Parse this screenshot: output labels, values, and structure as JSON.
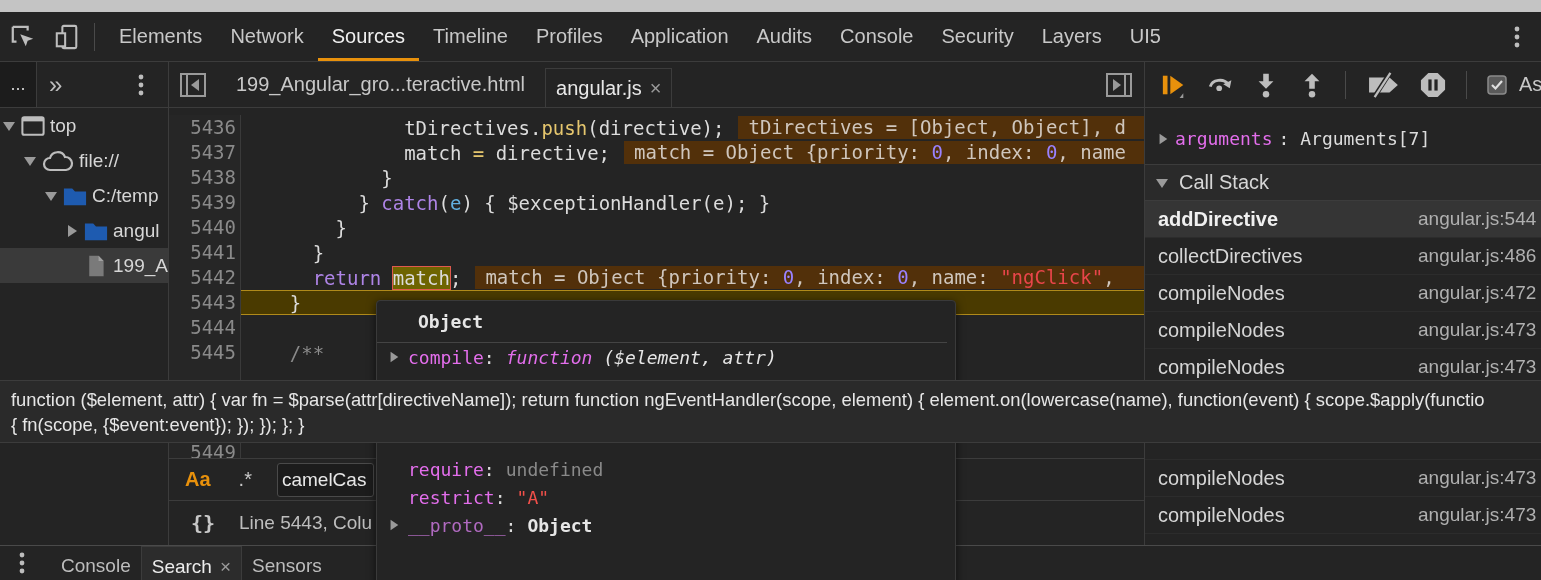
{
  "toolbar": {
    "tabs": [
      {
        "label": "Elements",
        "selected": false
      },
      {
        "label": "Network",
        "selected": false
      },
      {
        "label": "Sources",
        "selected": true
      },
      {
        "label": "Timeline",
        "selected": false
      },
      {
        "label": "Profiles",
        "selected": false
      },
      {
        "label": "Application",
        "selected": false
      },
      {
        "label": "Audits",
        "selected": false
      },
      {
        "label": "Console",
        "selected": false
      },
      {
        "label": "Security",
        "selected": false
      },
      {
        "label": "Layers",
        "selected": false
      },
      {
        "label": "UI5",
        "selected": false
      }
    ]
  },
  "navigator": {
    "overflow_tab": "...",
    "more_tabs": "»",
    "tree": [
      {
        "label": "top",
        "kind": "frame",
        "expanded": true,
        "selected": false,
        "children": [
          {
            "label": "file://",
            "kind": "cloud",
            "expanded": true,
            "selected": false,
            "children": [
              {
                "label": "C:/temp",
                "kind": "folder",
                "expanded": true,
                "selected": false,
                "children": [
                  {
                    "label": "angul",
                    "kind": "folder",
                    "expanded": false,
                    "selected": false
                  },
                  {
                    "label": "199_A",
                    "kind": "file",
                    "selected": true
                  }
                ]
              }
            ]
          }
        ]
      }
    ]
  },
  "editor": {
    "tabs": [
      {
        "label": "199_Angular_gro...teractive.html",
        "selected": false
      },
      {
        "label": "angular.js",
        "selected": true,
        "close": "×"
      }
    ],
    "lines": [
      {
        "number": "5436",
        "current": false,
        "tokens": [
          {
            "text": "              tDirectives.",
            "kind": "plain"
          },
          {
            "text": "push",
            "kind": "method"
          },
          {
            "text": "(directive);",
            "kind": "plain"
          }
        ],
        "annotation": [
          {
            "text": "tDirectives = [Object, Object], d",
            "kind": "plain"
          }
        ]
      },
      {
        "number": "5437",
        "current": false,
        "tokens": [
          {
            "text": "              match ",
            "kind": "plain"
          },
          {
            "text": "=",
            "kind": "method"
          },
          {
            "text": " directive;",
            "kind": "plain"
          }
        ],
        "annotation": [
          {
            "text": "match = Object {priority: ",
            "kind": "plain"
          },
          {
            "text": "0",
            "kind": "number"
          },
          {
            "text": ", index: ",
            "kind": "plain"
          },
          {
            "text": "0",
            "kind": "number"
          },
          {
            "text": ", name",
            "kind": "plain"
          }
        ]
      },
      {
        "number": "5438",
        "current": false,
        "tokens": [
          {
            "text": "            }",
            "kind": "plain"
          }
        ]
      },
      {
        "number": "5439",
        "current": false,
        "tokens": [
          {
            "text": "          }",
            "kind": "plain"
          },
          {
            "text": " catch",
            "kind": "keyword"
          },
          {
            "text": "(",
            "kind": "plain"
          },
          {
            "text": "e",
            "kind": "param"
          },
          {
            "text": ") { $exceptionHandler(e); }",
            "kind": "plain"
          }
        ]
      },
      {
        "number": "5440",
        "current": false,
        "tokens": [
          {
            "text": "        }",
            "kind": "plain"
          }
        ]
      },
      {
        "number": "5441",
        "current": false,
        "tokens": [
          {
            "text": "      }",
            "kind": "plain"
          }
        ]
      },
      {
        "number": "5442",
        "current": false,
        "tokens": [
          {
            "text": "      return ",
            "kind": "keyword"
          },
          {
            "text": "match",
            "kind": "hover"
          },
          {
            "text": ";",
            "kind": "plain"
          }
        ],
        "annotation": [
          {
            "text": "match = Object {priority: ",
            "kind": "plain"
          },
          {
            "text": "0",
            "kind": "number"
          },
          {
            "text": ", index: ",
            "kind": "plain"
          },
          {
            "text": "0",
            "kind": "number"
          },
          {
            "text": ", name: ",
            "kind": "plain"
          },
          {
            "text": "\"ngClick\"",
            "kind": "string"
          },
          {
            "text": ",",
            "kind": "plain"
          }
        ]
      },
      {
        "number": "5443",
        "current": true,
        "tokens": [
          {
            "text": "    }",
            "kind": "plain"
          }
        ]
      },
      {
        "number": "5444",
        "current": false
      },
      {
        "number": "5445",
        "current": false,
        "tokens": [
          {
            "text": "    /**",
            "kind": "comment"
          }
        ]
      },
      {
        "number": "5449",
        "current": false
      }
    ],
    "search": {
      "case_toggle": "Aa",
      "regex_toggle": ".*",
      "value": "camelCas"
    },
    "status": {
      "format_toggle": "{}",
      "position": "Line 5443, Colu"
    }
  },
  "popover": {
    "title": "Object",
    "rows": [
      {
        "key": "compile",
        "colon": ":",
        "kind": "function",
        "keyword": "function",
        "value": "($element, attr)",
        "expanded": false
      },
      {
        "key": "require",
        "colon": ":",
        "kind": "undefined",
        "value": "undefined"
      },
      {
        "key": "restrict",
        "colon": ":",
        "kind": "string",
        "value": "\"A\""
      },
      {
        "key": "__proto__",
        "colon": ":",
        "kind": "object",
        "value": "Object",
        "internal": true,
        "expanded": false
      }
    ]
  },
  "tooltip": {
    "lines": [
      "function ($element, attr) { var fn = $parse(attr[directiveName]); return function ngEventHandler(scope, element) { element.on(lowercase(name), function(event) { scope.$apply(functio",
      "{ fn(scope, {$event:event}); }); }); }; }"
    ]
  },
  "debugger": {
    "async": {
      "label": "As",
      "checked": true
    },
    "scope": [
      {
        "key": "arguments",
        "colon": ":",
        "value": "Arguments[7]",
        "expanded": false
      }
    ],
    "call_stack": {
      "title": "Call Stack",
      "expanded": true,
      "frames": [
        {
          "name": "addDirective",
          "location": "angular.js:544",
          "selected": true
        },
        {
          "name": "collectDirectives",
          "location": "angular.js:486",
          "selected": false
        },
        {
          "name": "compileNodes",
          "location": "angular.js:472",
          "selected": false
        },
        {
          "name": "compileNodes",
          "location": "angular.js:473",
          "selected": false
        },
        {
          "name": "compileNodes",
          "location": "angular.js:473",
          "selected": false
        },
        {
          "name": "compileNodes",
          "location": "angular.js:473",
          "selected": false
        },
        {
          "name": "compileNodes",
          "location": "angular.js:473",
          "selected": false
        }
      ]
    }
  },
  "drawer": {
    "tabs": [
      {
        "label": "Console",
        "selected": false
      },
      {
        "label": "Search",
        "selected": true,
        "close": "×"
      },
      {
        "label": "Sensors",
        "selected": false
      }
    ]
  }
}
